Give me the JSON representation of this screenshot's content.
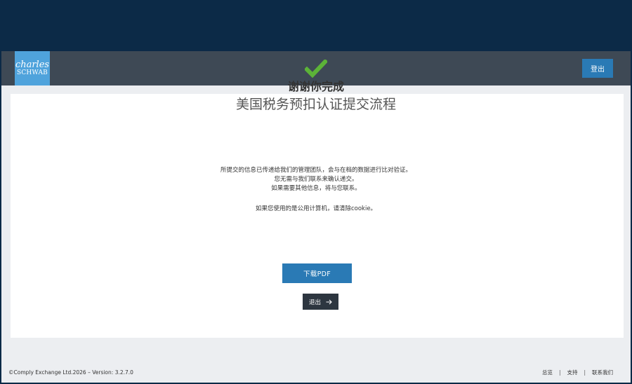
{
  "header": {
    "logo_line1": "charles",
    "logo_line2": "SCHWAB",
    "logout_label": "登出"
  },
  "confirmation": {
    "thanks": "谢谢你完成",
    "title": "美国税务预扣认证提交流程",
    "message_line1": "所提交的信息已传递给我们的管理团队，会与在档的数据进行比对验证。",
    "message_line2": "您无需与我们联系来确认递交。",
    "message_line3": "如果需要其他信息，将与您联系。",
    "cookie_notice": "如果您使用的是公用计算机，请清除cookie。",
    "download_label": "下载PDF",
    "exit_label": "退出",
    "check_color": "#5cb338"
  },
  "footer": {
    "copyright": "©Comply Exchange Ltd.2026 – Version: 3.2.7.0",
    "links": [
      "总览",
      "支持",
      "联系我们"
    ],
    "separator": "|"
  },
  "colors": {
    "top_band": "#0c2a47",
    "header": "#3e4955",
    "logo_bg": "#4fa3dc",
    "primary_button": "#2a7ab5",
    "dark_button": "#2d3640"
  }
}
